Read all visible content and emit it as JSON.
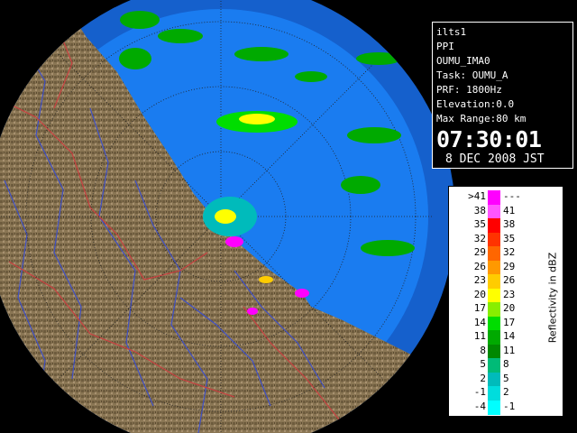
{
  "radar_info": {
    "product": "ilts1",
    "mode": "PPI",
    "site": "OUMU_IMA0",
    "task": "Task: OUMU_A",
    "prf": "PRF: 1800Hz",
    "elevation": "Elevation:0.0",
    "max_range": "Max Range:80 km",
    "time": "07:30:01",
    "date": "8 DEC 2008 JST"
  },
  "legend": {
    "title": "Reflectivity in dBZ",
    "rows": [
      {
        "low": ">41",
        "high": "---",
        "color": "#ff00ff"
      },
      {
        "low": "38",
        "high": "41",
        "color": "#ff55ff"
      },
      {
        "low": "35",
        "high": "38",
        "color": "#ff0000"
      },
      {
        "low": "32",
        "high": "35",
        "color": "#ff3300"
      },
      {
        "low": "29",
        "high": "32",
        "color": "#ff6600"
      },
      {
        "low": "26",
        "high": "29",
        "color": "#ff9900"
      },
      {
        "low": "23",
        "high": "26",
        "color": "#ffcc00"
      },
      {
        "low": "20",
        "high": "23",
        "color": "#ffff00"
      },
      {
        "low": "17",
        "high": "20",
        "color": "#88ee00"
      },
      {
        "low": "14",
        "high": "17",
        "color": "#00dd00"
      },
      {
        "low": "11",
        "high": "14",
        "color": "#00aa00"
      },
      {
        "low": "8",
        "high": "11",
        "color": "#008800"
      },
      {
        "low": "5",
        "high": "8",
        "color": "#00bb77"
      },
      {
        "low": "2",
        "high": "5",
        "color": "#00bbbb"
      },
      {
        "low": "-1",
        "high": "2",
        "color": "#00dddd"
      },
      {
        "low": "-4",
        "high": "-1",
        "color": "#00ffff"
      }
    ]
  },
  "colors": {
    "ocean_outer": "#1560cc",
    "ocean_inner": "#1a7cf0",
    "land": "#8a7654",
    "rivers": "#3e4fc4",
    "boundaries": "#c84040",
    "range_rings": "#222222"
  }
}
